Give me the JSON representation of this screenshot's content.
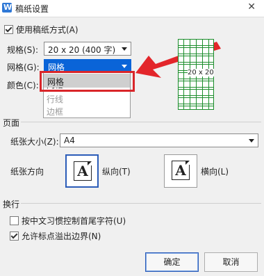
{
  "window": {
    "title": "稿纸设置",
    "app_icon_letter": "W",
    "close_glyph": "✕"
  },
  "use_grid": {
    "label": "使用稿纸方式(A)",
    "checked": true
  },
  "spec": {
    "label": "规格(S):",
    "value": "20 x 20 (400 字)"
  },
  "grid_type": {
    "label": "网格(G):",
    "value": "网格"
  },
  "color": {
    "label": "颜色(C):"
  },
  "dropdown_options": [
    "网格",
    "行线",
    "边框"
  ],
  "preview": {
    "label": "20 x 20"
  },
  "page": {
    "section_label": "页面",
    "paper_size_label": "纸张大小(Z):",
    "paper_size_value": "A4",
    "orientation_label": "纸张方向",
    "portrait_label": "纵向(T)",
    "landscape_label": "横向(L)",
    "letter": "A"
  },
  "line_break": {
    "section_label": "换行",
    "option1_label": "按中文习惯控制首尾字符(U)",
    "option1_checked": false,
    "option2_label": "允许标点溢出边界(N)",
    "option2_checked": true
  },
  "buttons": {
    "ok": "确定",
    "cancel": "取消"
  },
  "colors": {
    "highlight_red": "#d9262a",
    "grid_green": "#1a8c2a",
    "accent_blue": "#0a64d8"
  }
}
